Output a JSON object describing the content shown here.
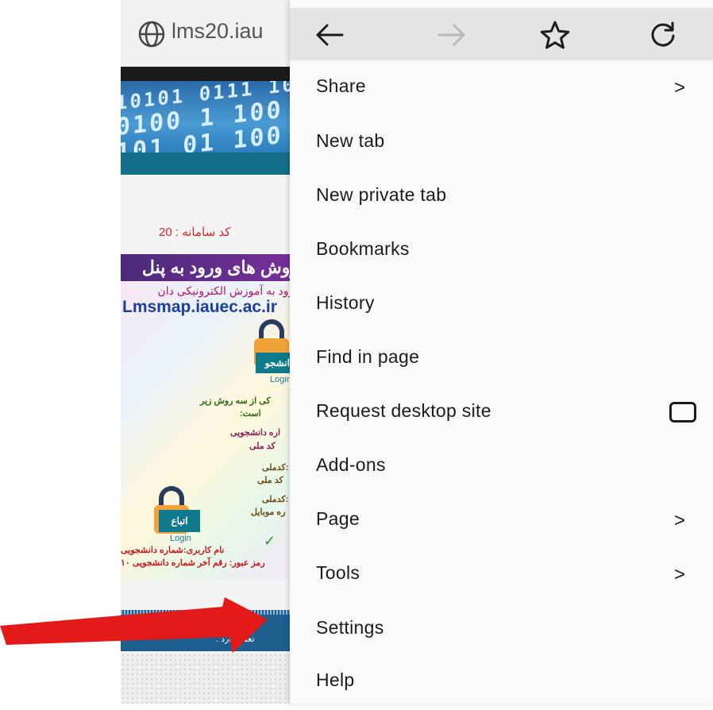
{
  "browser": {
    "url_text": "lms20.iau",
    "page": {
      "code_label": "کد سامانه : 20",
      "poster_title": "روش های ورود به پنل",
      "poster_subtitle": "ورود به آموزش الکترونیکی دان",
      "poster_url": "Lmsmap.iauec.ac.ir",
      "lock_student_tag": "دانشجو",
      "lock_login_text": "Login",
      "lock_atba_tag": "اتباع",
      "lock_atba_login": "Login",
      "poster_lines": [
        "کی از سه روش زیر",
        "است:",
        "اره دانشجویی",
        "کد ملی",
        ":کدملی",
        "کد ملی",
        ":کدملی",
        "ره موبایل",
        "نام کاربری:شماره دانشجویی",
        "رمز عبور: رقم آخر شماره دانشجویی ۱۰"
      ],
      "footer_text": "تعلق دارد ."
    }
  },
  "menu": {
    "toolbar": {
      "back_icon": "back-arrow-icon",
      "forward_icon": "forward-arrow-icon",
      "star_icon": "star-icon",
      "reload_icon": "reload-icon"
    },
    "items": [
      {
        "label": "Share",
        "chevron": ">"
      },
      {
        "label": "New tab"
      },
      {
        "label": "New private tab"
      },
      {
        "label": "Bookmarks"
      },
      {
        "label": "History"
      },
      {
        "label": "Find in page"
      },
      {
        "label": "Request desktop site",
        "checkbox": false
      },
      {
        "label": "Add-ons"
      },
      {
        "label": "Page",
        "chevron": ">"
      },
      {
        "label": "Tools",
        "chevron": ">"
      },
      {
        "label": "Settings"
      },
      {
        "label": "Help"
      }
    ]
  },
  "annotation": {
    "arrow_color": "#e41a1a",
    "points_to": "Settings"
  }
}
